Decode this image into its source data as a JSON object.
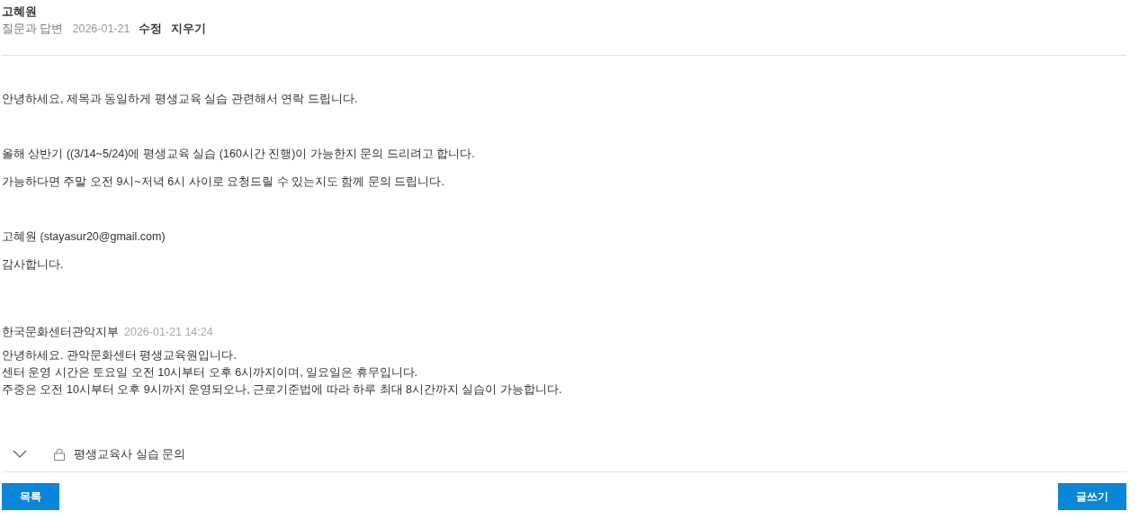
{
  "post": {
    "author": "고혜원",
    "board": "질문과 답변",
    "date": "2026-01-21",
    "actions": [
      "수정",
      "지우기"
    ],
    "body_groups": [
      [
        "안녕하세요, 제목과 동일하게 평생교육 실습 관련해서 연락 드립니다."
      ],
      [
        "올해 상반기 ((3/14~5/24)에 평생교육 실습 (160시간 진행)이 가능한지 문의 드리려고 합니다.",
        "가능하다면 주말 오전 9시~저녁 6시 사이로 요청드릴 수 있는지도 함께 문의 드립니다."
      ],
      [
        "고혜원 (stayasur20@gmail.com)",
        "감사합니다."
      ]
    ]
  },
  "reply": {
    "author": "한국문화센터관악지부",
    "datetime": "2026-01-21 14:24",
    "lines": [
      "안녕하세요. 관악문화센터 평생교육원입니다.",
      "센터 운영 시간은 토요일 오전 10시부터 오후 6시까지이며, 일요일은 휴무입니다.",
      "주중은 오전 10시부터 오후 9시까지 운영되오나, 근로기준법에 따라 하루 최대 8시간까지 실습이 가능합니다."
    ]
  },
  "thread": {
    "expanded": false,
    "locked": true,
    "title": "평생교육사 실습 문의"
  },
  "buttons": {
    "left": "목록",
    "right": "글쓰기"
  }
}
